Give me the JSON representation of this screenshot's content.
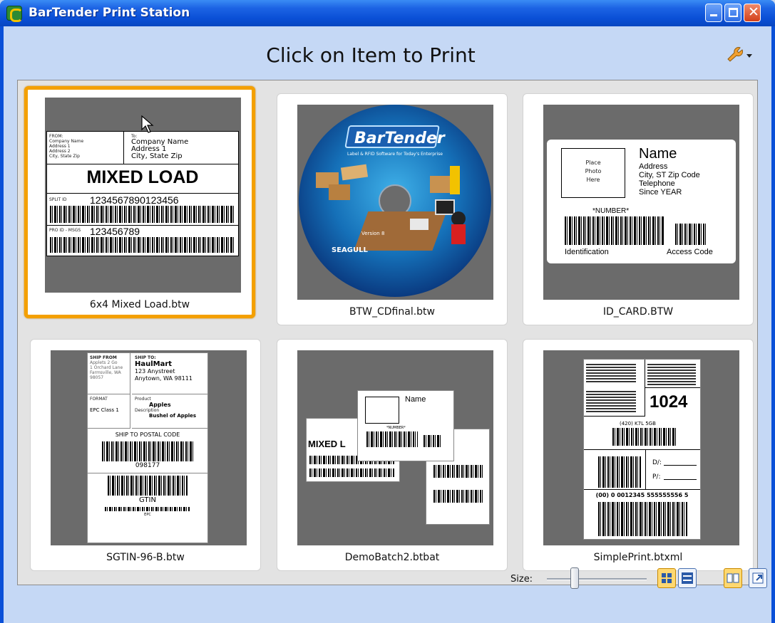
{
  "window": {
    "title": "BarTender Print Station"
  },
  "header": {
    "title": "Click on Item to Print"
  },
  "items": [
    {
      "label": "6x4 Mixed Load.btw",
      "selected": true
    },
    {
      "label": "BTW_CDfinal.btw",
      "selected": false
    },
    {
      "label": "ID_CARD.BTW",
      "selected": false
    },
    {
      "label": "SGTIN-96-B.btw",
      "selected": false
    },
    {
      "label": "DemoBatch2.btbat",
      "selected": false
    },
    {
      "label": "SimplePrint.btxml",
      "selected": false
    }
  ],
  "thumbs": {
    "mixed": {
      "from_head": "FROM:",
      "from_lines": [
        "Company Name",
        "Address 1",
        "Address 2",
        "City, State Zip"
      ],
      "to_head": "To:",
      "to_lines": [
        "Company Name",
        "Address 1",
        "City, State  Zip"
      ],
      "title": "MIXED LOAD",
      "sscc_head": "SPLIT ID",
      "sscc_number": "1234567890123456",
      "po_head": "PRO ID - MSGS",
      "po_number": "123456789"
    },
    "cd": {
      "brand": "BarTender",
      "tagline": "Label & RFID Software for Today's Enterprise",
      "version": "Version 8",
      "maker": "SEAGULL"
    },
    "id_card": {
      "photo": [
        "Place",
        "Photo",
        "Here"
      ],
      "name": "Name",
      "lines": [
        "Address",
        "City, ST  Zip Code",
        "Telephone",
        "Since YEAR"
      ],
      "number": "*NUMBER*",
      "left_caption": "Identification",
      "right_caption": "Access Code"
    },
    "sgtin": {
      "ship_from": "SHIP FROM",
      "from_lines": [
        "Applets 2 Go",
        "1 Orchard Lane",
        "Farmsville, WA",
        "98057"
      ],
      "ship_to": "SHIP TO:",
      "to_company": "HaulMart",
      "to_lines": [
        "123 Anystreet",
        "Anytown, WA 98111"
      ],
      "format_head": "FORMAT",
      "format": "EPC Class 1",
      "product_head": "Product",
      "product": "Apples",
      "desc_head": "Description",
      "desc": "Bushel of Apples",
      "postal_head": "SHIP TO POSTAL CODE",
      "postal": "098177",
      "gtin": "GTIN",
      "epc": "EPC"
    },
    "batch": {
      "name": "Name",
      "number": "*NUMBER*",
      "mixed": "MIXED L"
    },
    "simple": {
      "big_number": "1024",
      "code_a": "(420) K7L 5GB",
      "code_b": "(00) 0 0012345 555555556 5",
      "d_label": "D/:",
      "p_label": "P/:"
    }
  },
  "footer": {
    "size_label": "Size:"
  }
}
